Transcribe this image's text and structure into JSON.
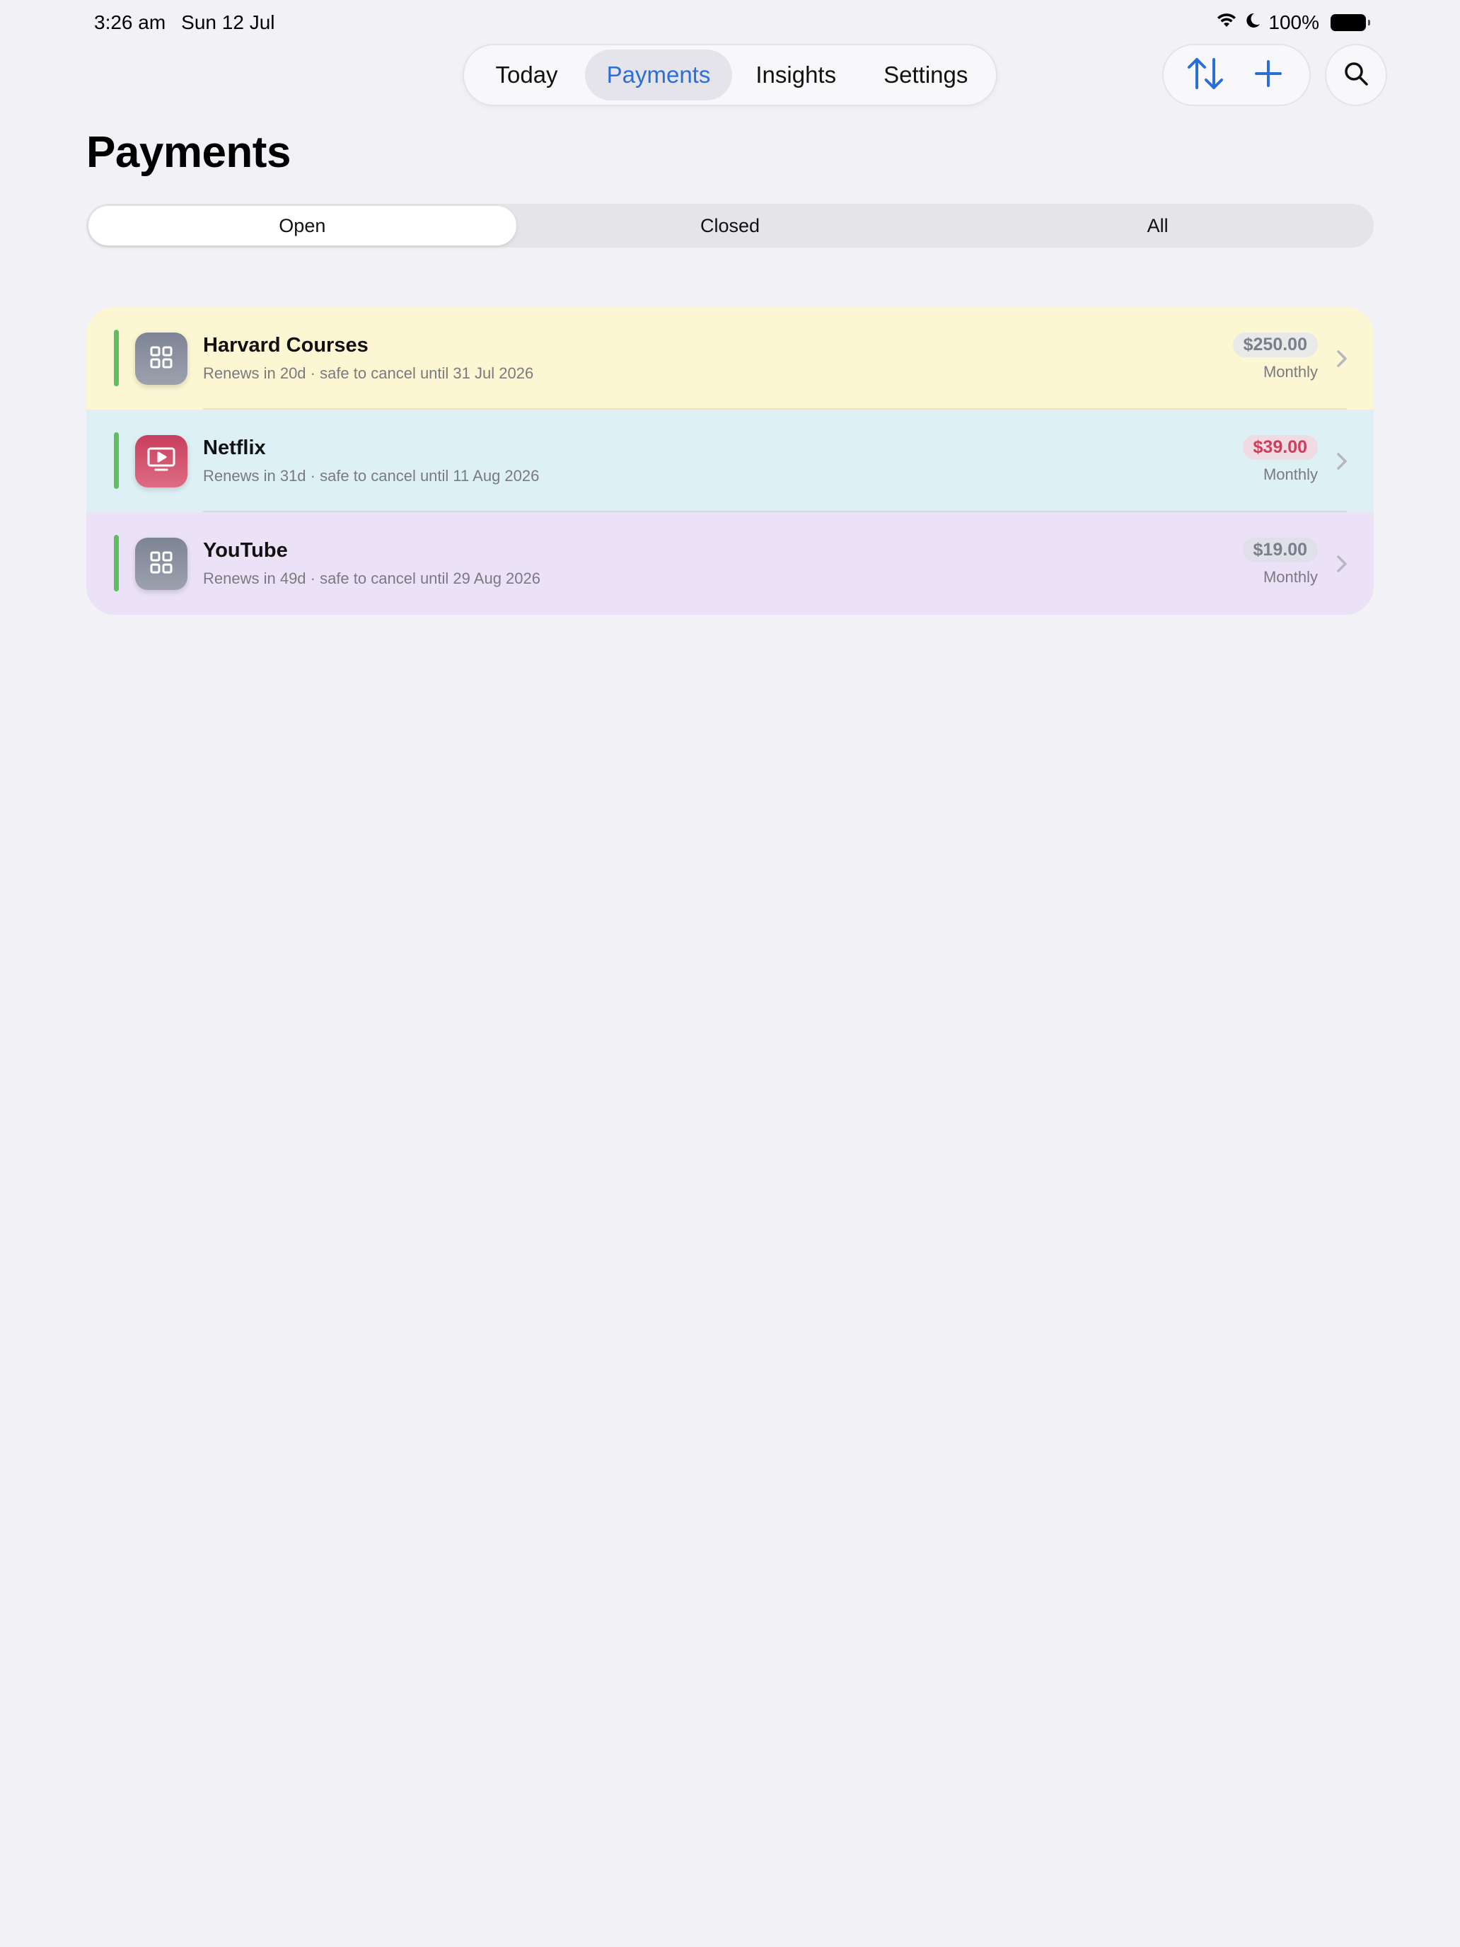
{
  "status_bar": {
    "time": "3:26 am",
    "date": "Sun 12 Jul",
    "battery_pct": "100%"
  },
  "nav": {
    "tabs": [
      {
        "label": "Today",
        "active": false
      },
      {
        "label": "Payments",
        "active": true
      },
      {
        "label": "Insights",
        "active": false
      },
      {
        "label": "Settings",
        "active": false
      }
    ],
    "actions": [
      "sort-icon",
      "plus-icon"
    ],
    "search_icon": "search-icon"
  },
  "page": {
    "title": "Payments"
  },
  "filter": {
    "segments": [
      {
        "label": "Open",
        "selected": true
      },
      {
        "label": "Closed",
        "selected": false
      },
      {
        "label": "All",
        "selected": false
      }
    ]
  },
  "payments": [
    {
      "name": "Harvard Courses",
      "subtitle": "Renews in 20d · safe to cancel until 31 Jul 2026",
      "amount": "$250.00",
      "period": "Monthly",
      "icon": "grid-icon",
      "row_color": "#fcf6d3",
      "amount_color": "#7a7f8c",
      "amount_bg": "#e9e9ea"
    },
    {
      "name": "Netflix",
      "subtitle": "Renews in 31d · safe to cancel until 11 Aug 2026",
      "amount": "$39.00",
      "period": "Monthly",
      "icon": "tv-play-icon",
      "row_color": "#dcf0f6",
      "amount_color": "#d23c5c",
      "amount_bg": "#f1dbe3"
    },
    {
      "name": "YouTube",
      "subtitle": "Renews in 49d · safe to cancel until 29 Aug 2026",
      "amount": "$19.00",
      "period": "Monthly",
      "icon": "grid-icon",
      "row_color": "#ebe2f8",
      "amount_color": "#7a7f8c",
      "amount_bg": "#e1dfea"
    }
  ],
  "colors": {
    "accent_blue": "#2b6fd6",
    "status_green": "#5fbe5f",
    "background": "#f2f1f6"
  }
}
